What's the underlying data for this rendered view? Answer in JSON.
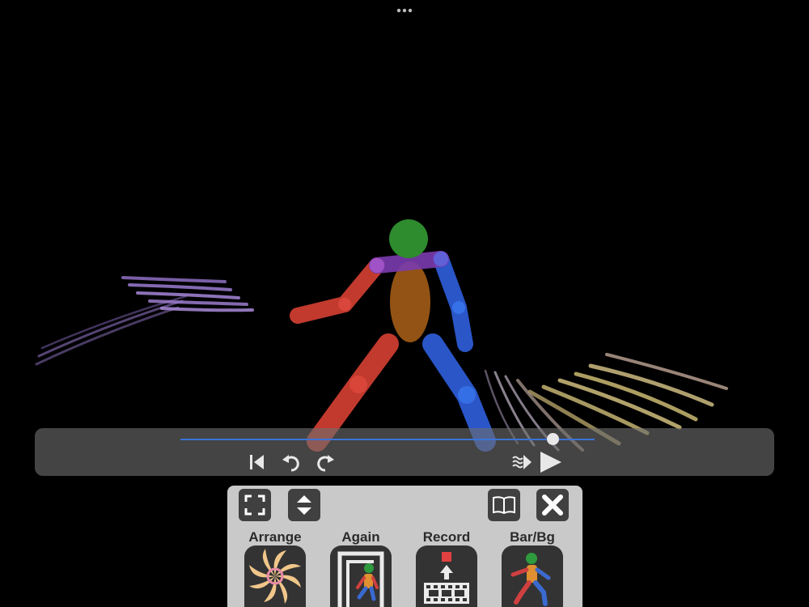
{
  "toolbar": {
    "arrange_label": "Arrange",
    "again_label": "Again",
    "record_label": "Record",
    "barbg_label": "Bar/Bg"
  },
  "timeline": {
    "position": 0.9
  },
  "icons": {
    "more": "more-dots-icon",
    "skip_start": "skip-to-start-icon",
    "undo": "undo-icon",
    "redo": "redo-icon",
    "speed": "speed-icon",
    "play": "play-icon",
    "fullscreen": "fullscreen-icon",
    "collapse": "expand-collapse-icon",
    "guide": "book-icon",
    "close": "close-icon"
  },
  "colors": {
    "background": "#000000",
    "head": "#2e8b2e",
    "torso": "#a05a16",
    "shoulders": "#7a3bb0",
    "left_limbs": "#c23a2e",
    "right_limbs": "#2a56c8",
    "timeline_track": "#3a73d9"
  }
}
